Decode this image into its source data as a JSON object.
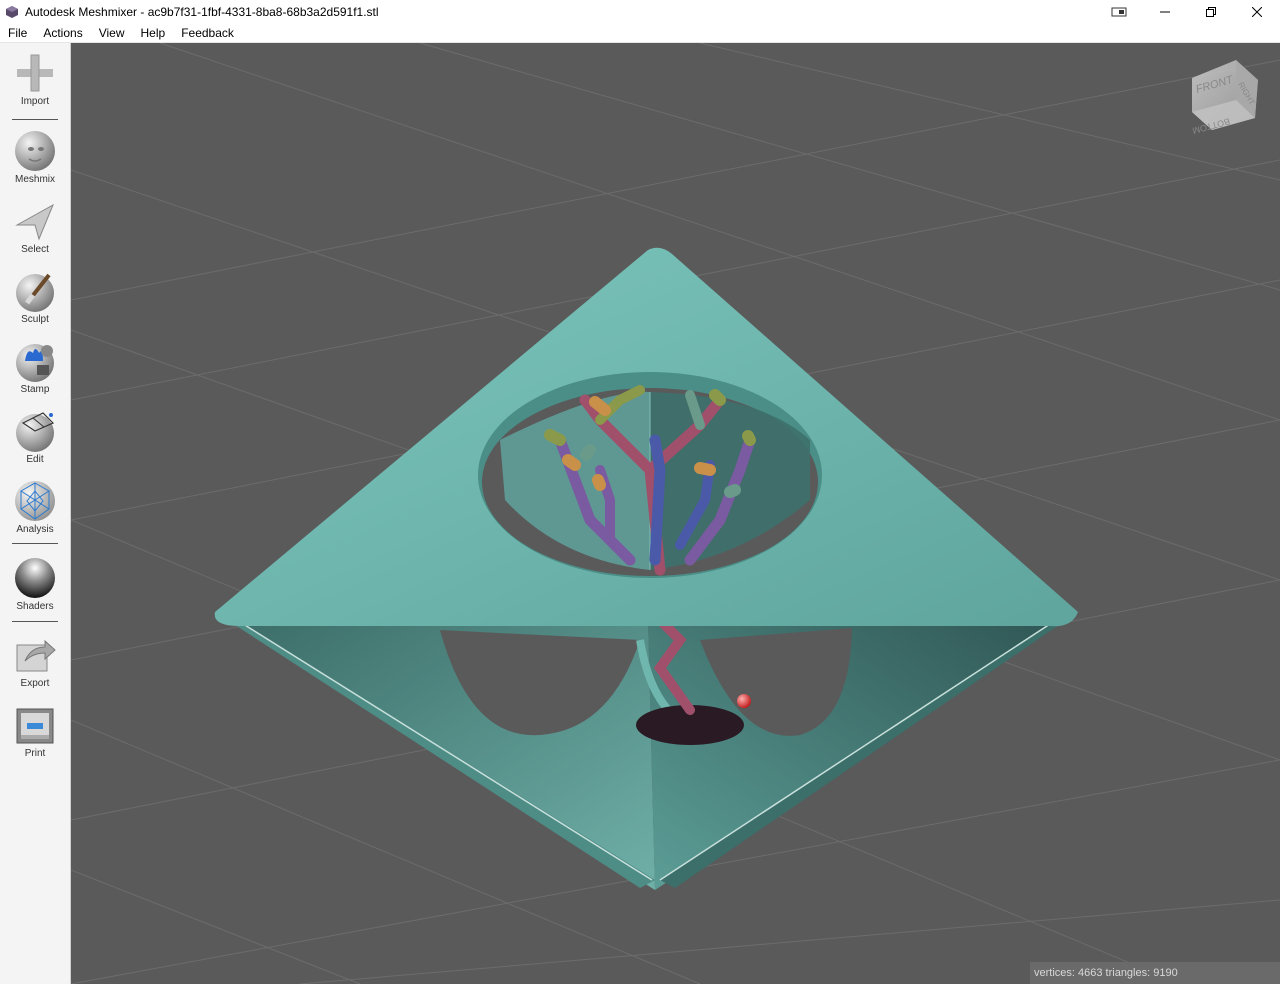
{
  "window": {
    "title": "Autodesk Meshmixer - ac9b7f31-1fbf-4331-8ba8-68b3a2d591f1.stl",
    "controls": [
      "restore-down",
      "minimize",
      "maximize",
      "close"
    ]
  },
  "menubar": {
    "items": [
      "File",
      "Actions",
      "View",
      "Help",
      "Feedback"
    ]
  },
  "toolbar": {
    "items": [
      {
        "label": "Import",
        "icon": "plus-icon"
      },
      {
        "label": "Meshmix",
        "icon": "face-sphere-icon"
      },
      {
        "label": "Select",
        "icon": "arrow-cursor-icon"
      },
      {
        "label": "Sculpt",
        "icon": "brush-sphere-icon"
      },
      {
        "label": "Stamp",
        "icon": "stamp-sphere-icon"
      },
      {
        "label": "Edit",
        "icon": "mesh-sphere-icon"
      },
      {
        "label": "Analysis",
        "icon": "wireframe-sphere-icon"
      },
      {
        "label": "Shaders",
        "icon": "chrome-sphere-icon"
      },
      {
        "label": "Export",
        "icon": "export-arrow-icon"
      },
      {
        "label": "Print",
        "icon": "printer-icon"
      }
    ]
  },
  "viewcube": {
    "faces": [
      "FRONT",
      "RIGHT",
      "BOTTOM"
    ]
  },
  "status": {
    "text": "vertices: 4663 triangles: 9190"
  },
  "colors": {
    "viewport_bg": "#5a5a5a",
    "model_teal": "#6fb6ae",
    "support_purple": "#7a5aa0",
    "support_red": "#a0506a",
    "support_blue": "#4a5aa8",
    "support_olive": "#8a9a4a"
  }
}
